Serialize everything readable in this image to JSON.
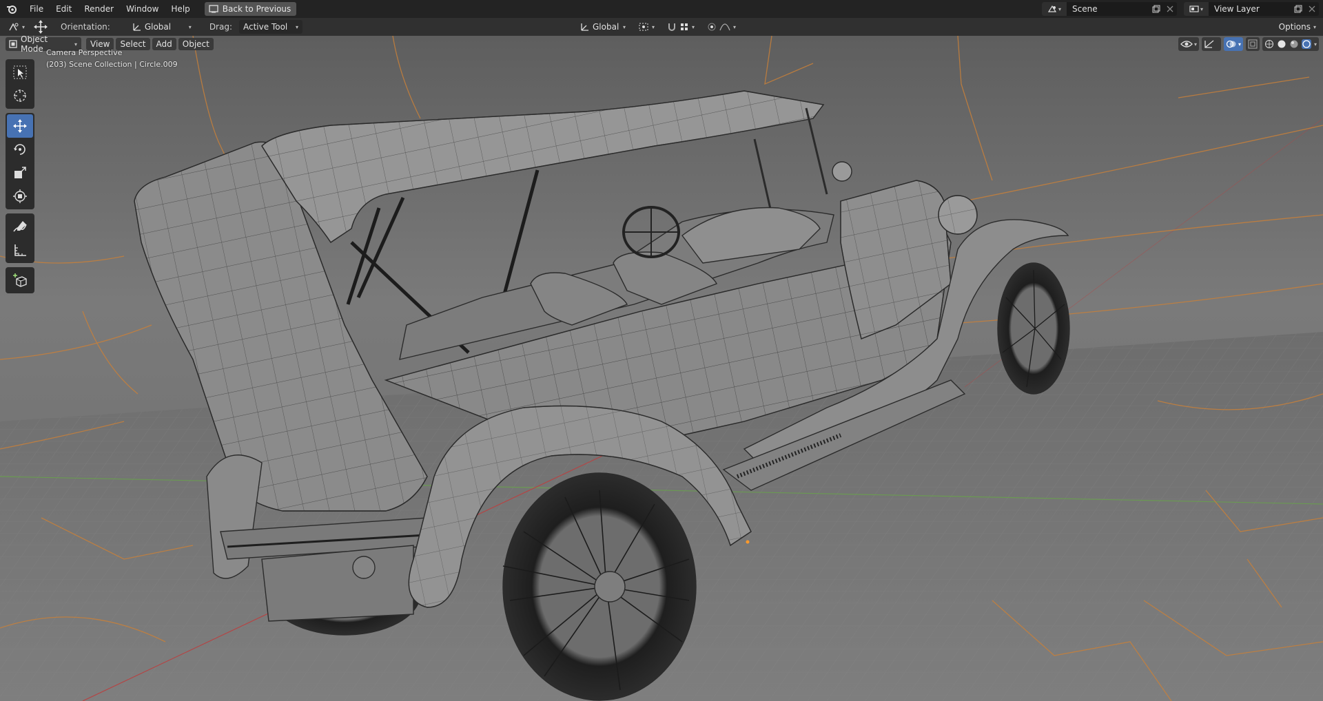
{
  "menu": {
    "items": [
      "File",
      "Edit",
      "Render",
      "Window",
      "Help"
    ],
    "back_button": "Back to Previous"
  },
  "topright": {
    "scene_label": "Scene",
    "view_layer_label": "View Layer"
  },
  "toolbar": {
    "orientation_label": "Orientation:",
    "orientation_value": "Global",
    "drag_label": "Drag:",
    "drag_value": "Active Tool",
    "transform_orientation": "Global",
    "options_label": "Options"
  },
  "viewport": {
    "mode": "Object Mode",
    "menus": [
      "View",
      "Select",
      "Add",
      "Object"
    ],
    "camera_text": "Camera Perspective",
    "collection_text": "(203) Scene Collection | Circle.009"
  },
  "tools": [
    "select-box",
    "cursor",
    "move",
    "rotate",
    "scale",
    "transform",
    "annotate",
    "measure",
    "add-cube"
  ],
  "colors": {
    "accent": "#4772b3",
    "grid_orange": "#c8803a",
    "mesh": "#8c8c8c"
  }
}
